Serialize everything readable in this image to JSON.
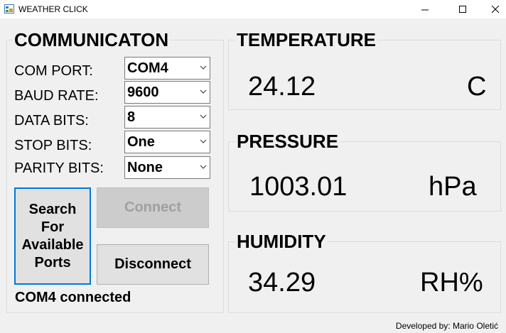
{
  "window": {
    "title": "WEATHER CLICK",
    "minimize": "—",
    "maximize": "☐",
    "close": "✕",
    "icon": "app-icon"
  },
  "communication": {
    "title": "COMMUNICATON",
    "com_port_label": "COM PORT:",
    "com_port_value": "COM4",
    "baud_rate_label": "BAUD RATE:",
    "baud_rate_value": "9600",
    "data_bits_label": "DATA BITS:",
    "data_bits_value": "8",
    "stop_bits_label": "STOP BITS:",
    "stop_bits_value": "One",
    "parity_bits_label": "PARITY BITS:",
    "parity_bits_value": "None",
    "search_line1": "Search",
    "search_line2": "For",
    "search_line3": "Available",
    "search_line4": "Ports",
    "connect_label": "Connect",
    "disconnect_label": "Disconnect",
    "status": "COM4 connected"
  },
  "temperature": {
    "title": "TEMPERATURE",
    "value": "24.12",
    "unit": "C"
  },
  "pressure": {
    "title": "PRESSURE",
    "value": "1003.01",
    "unit": "hPa"
  },
  "humidity": {
    "title": "HUMIDITY",
    "value": "34.29",
    "unit": "RH%"
  },
  "footer": {
    "credit": "Developed by: Mario Oletić"
  },
  "colors": {
    "focus_border": "#0078d7",
    "window_bg": "#f0f0f0"
  }
}
